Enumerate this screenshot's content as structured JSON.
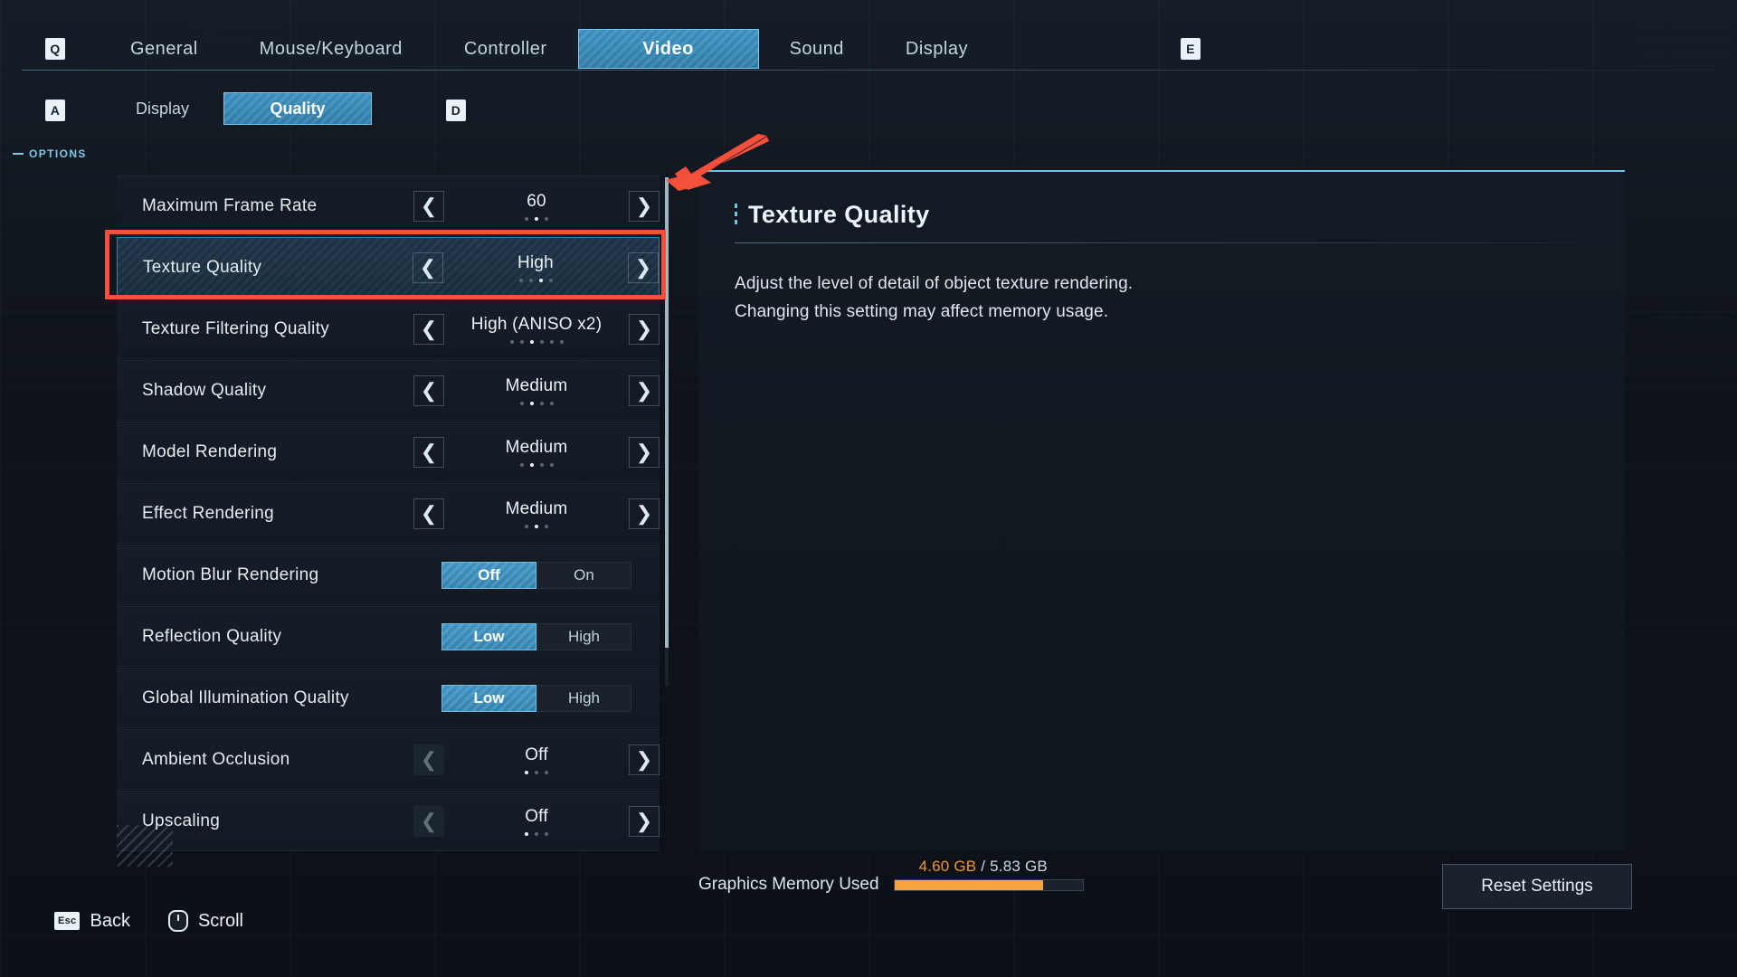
{
  "top_nav": {
    "prev_key": "Q",
    "next_key": "E",
    "tabs": [
      {
        "label": "General",
        "active": false
      },
      {
        "label": "Mouse/Keyboard",
        "active": false
      },
      {
        "label": "Controller",
        "active": false
      },
      {
        "label": "Video",
        "active": true
      },
      {
        "label": "Sound",
        "active": false
      },
      {
        "label": "Display",
        "active": false
      }
    ]
  },
  "sub_nav": {
    "prev_key": "A",
    "next_key": "D",
    "tabs": [
      {
        "label": "Display",
        "active": false
      },
      {
        "label": "Quality",
        "active": true
      }
    ]
  },
  "options_header": "OPTIONS",
  "settings": [
    {
      "label": "Maximum Frame Rate",
      "type": "stepper",
      "value": "60",
      "dots": 3,
      "active_dot": 2,
      "left_enabled": true,
      "right_enabled": true,
      "selected": false
    },
    {
      "label": "Texture Quality",
      "type": "stepper",
      "value": "High",
      "dots": 4,
      "active_dot": 3,
      "left_enabled": true,
      "right_enabled": true,
      "selected": true
    },
    {
      "label": "Texture Filtering Quality",
      "type": "stepper",
      "value": "High (ANISO x2)",
      "dots": 6,
      "active_dot": 3,
      "left_enabled": true,
      "right_enabled": true,
      "selected": false
    },
    {
      "label": "Shadow Quality",
      "type": "stepper",
      "value": "Medium",
      "dots": 4,
      "active_dot": 2,
      "left_enabled": true,
      "right_enabled": true,
      "selected": false
    },
    {
      "label": "Model Rendering",
      "type": "stepper",
      "value": "Medium",
      "dots": 4,
      "active_dot": 2,
      "left_enabled": true,
      "right_enabled": true,
      "selected": false
    },
    {
      "label": "Effect Rendering",
      "type": "stepper",
      "value": "Medium",
      "dots": 3,
      "active_dot": 2,
      "left_enabled": true,
      "right_enabled": true,
      "selected": false
    },
    {
      "label": "Motion Blur Rendering",
      "type": "toggle",
      "options": [
        "Off",
        "On"
      ],
      "selected_index": 0,
      "selected": false
    },
    {
      "label": "Reflection Quality",
      "type": "toggle",
      "options": [
        "Low",
        "High"
      ],
      "selected_index": 0,
      "selected": false
    },
    {
      "label": "Global Illumination Quality",
      "type": "toggle",
      "options": [
        "Low",
        "High"
      ],
      "selected_index": 0,
      "selected": false
    },
    {
      "label": "Ambient Occlusion",
      "type": "stepper",
      "value": "Off",
      "dots": 3,
      "active_dot": 1,
      "left_enabled": false,
      "right_enabled": true,
      "selected": false
    },
    {
      "label": "Upscaling",
      "type": "stepper",
      "value": "Off",
      "dots": 3,
      "active_dot": 1,
      "left_enabled": false,
      "right_enabled": true,
      "selected": false
    }
  ],
  "detail": {
    "title": "Texture Quality",
    "description_line1": "Adjust the level of detail of object texture rendering.",
    "description_line2": "Changing this setting may affect memory usage."
  },
  "memory": {
    "label": "Graphics Memory Used",
    "used": "4.60 GB",
    "separator": "/",
    "total": "5.83 GB",
    "fill_percent": 79
  },
  "reset_button": "Reset Settings",
  "footer": [
    {
      "key": "Esc",
      "label": "Back",
      "icon": "esc-key-icon"
    },
    {
      "key": "",
      "label": "Scroll",
      "icon": "mouse-wheel-icon"
    }
  ],
  "colors": {
    "accent_blue": "#3a8fbe",
    "accent_cyan": "#6fc4e8",
    "annotation_red": "#f4503c",
    "memory_orange": "#f5a33c"
  },
  "background_artifacts": {
    "ghost_label": "Settings",
    "ghost_options": "OPTIONS"
  }
}
